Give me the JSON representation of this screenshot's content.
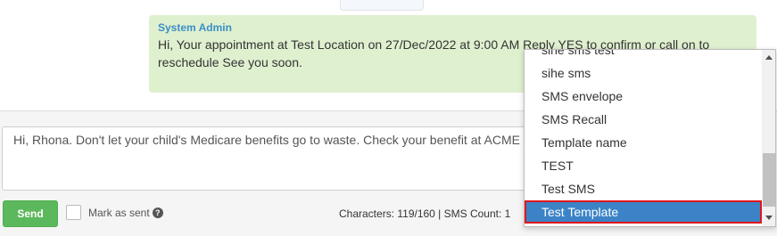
{
  "message": {
    "author": "System Admin",
    "text": "Hi, Your appointment at Test Location on 27/Dec/2022 at 9:00 AM Reply YES to confirm or call on to reschedule See you soon."
  },
  "compose": {
    "text": "Hi, Rhona. Don't let your child's Medicare benefits go to waste. Check your benefit at  ACME"
  },
  "footer": {
    "send_label": "Send",
    "mark_sent_label": "Mark as sent",
    "help_icon": "question-circle-icon",
    "char_count": "Characters: 119/160 | SMS Count: 1"
  },
  "dropdown": {
    "items": [
      {
        "label": "sihe sms test"
      },
      {
        "label": "sihe sms"
      },
      {
        "label": "SMS envelope"
      },
      {
        "label": "SMS Recall"
      },
      {
        "label": "Template name"
      },
      {
        "label": "TEST"
      },
      {
        "label": "Test SMS"
      },
      {
        "label": "Test Template",
        "selected": true
      }
    ]
  },
  "colors": {
    "send_button": "#5cb85c",
    "message_bubble": "#dff0cf",
    "author": "#3a8fc7",
    "selected_item": "#3b83c6",
    "highlight_outline": "#e0161c"
  }
}
